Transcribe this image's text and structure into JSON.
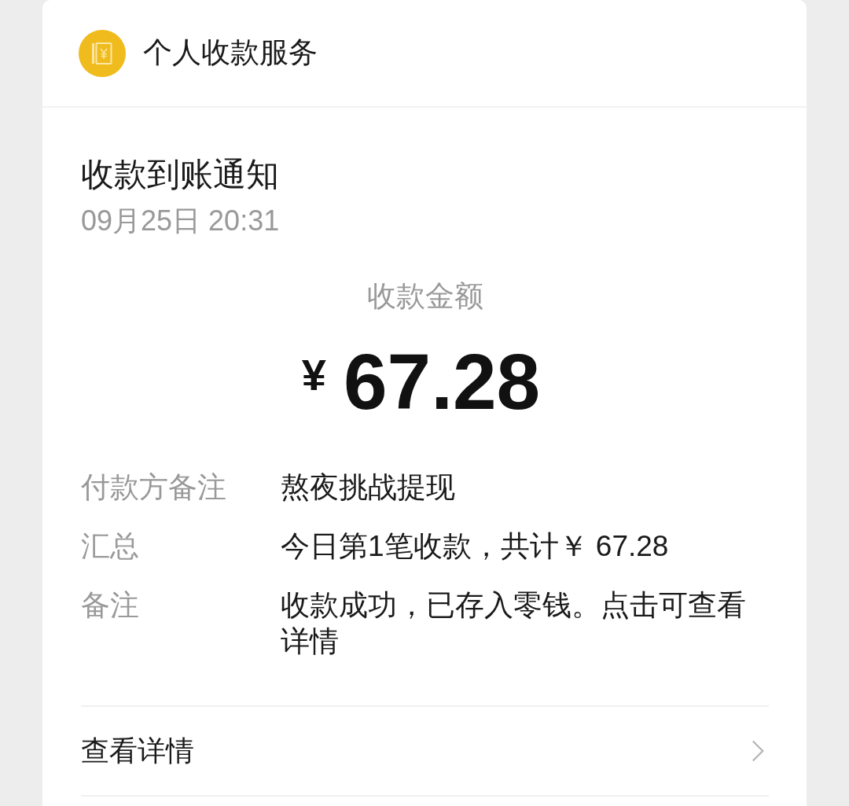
{
  "header": {
    "title": "个人收款服务"
  },
  "notice": {
    "title": "收款到账通知",
    "time": "09月25日 20:31"
  },
  "amount": {
    "label": "收款金额",
    "currency": "¥",
    "value": "67.28"
  },
  "details": [
    {
      "label": "付款方备注",
      "value": "熬夜挑战提现"
    },
    {
      "label": "汇总",
      "value": "今日第1笔收款，共计￥ 67.28"
    },
    {
      "label": "备注",
      "value": "收款成功，已存入零钱。点击可查看详情"
    }
  ],
  "link": {
    "label": "查看详情"
  }
}
